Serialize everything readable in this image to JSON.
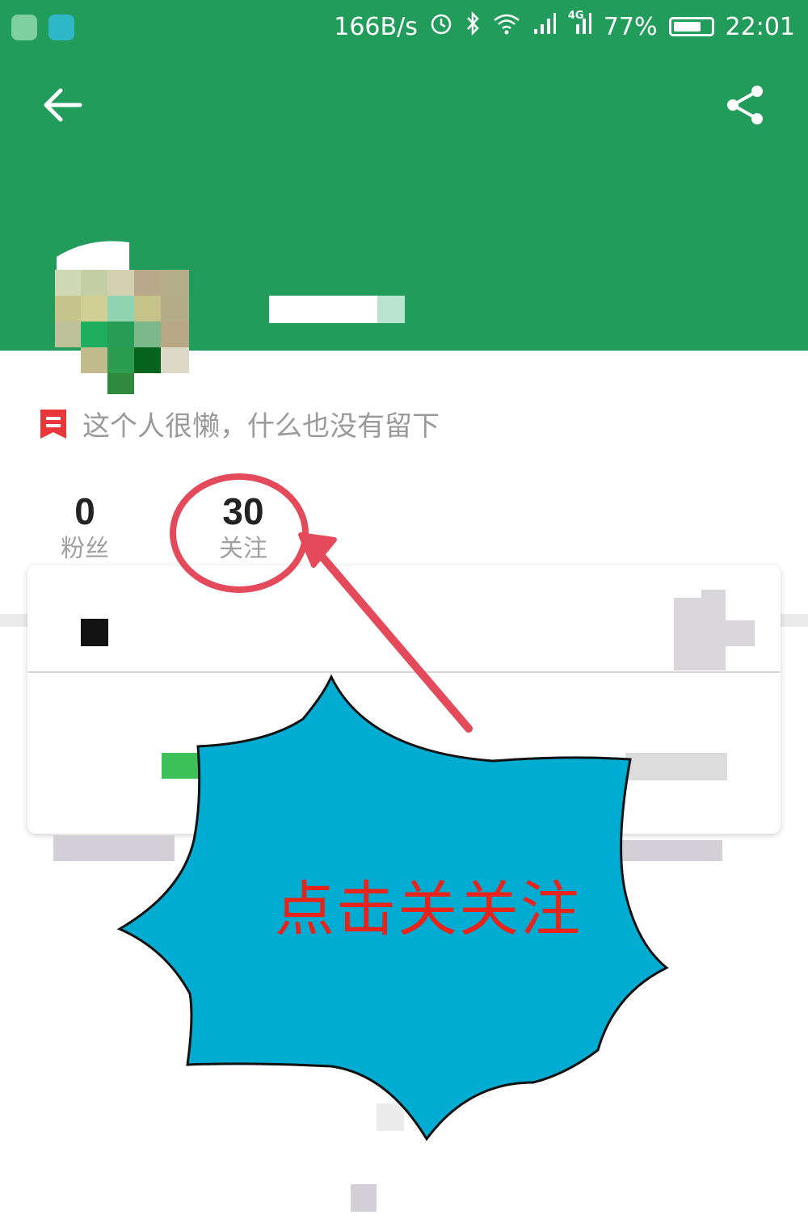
{
  "status_bar": {
    "network_speed": "166B/s",
    "signal_type": "4G",
    "battery": "77%",
    "battery_level": 0.77,
    "time": "22:01",
    "icons": [
      "app-notification-icon",
      "qq-icon",
      "alarm-icon",
      "bluetooth-icon",
      "wifi-icon",
      "signal-icon",
      "4g-signal-icon",
      "battery-icon"
    ]
  },
  "header": {
    "background_color": "#219c5a",
    "back_icon": "arrow-left-icon",
    "share_icon": "share-icon"
  },
  "profile": {
    "bio": "这个人很懒，什么也没有留下",
    "bio_icon": "bookmark-icon",
    "stats": [
      {
        "value": "0",
        "label": "粉丝"
      },
      {
        "value": "30",
        "label": "关注"
      }
    ]
  },
  "annotation": {
    "callout_text": "点击关关注",
    "callout_color": "#00acd2",
    "text_color": "#e8231a",
    "circle_color": "#e44a5a"
  }
}
